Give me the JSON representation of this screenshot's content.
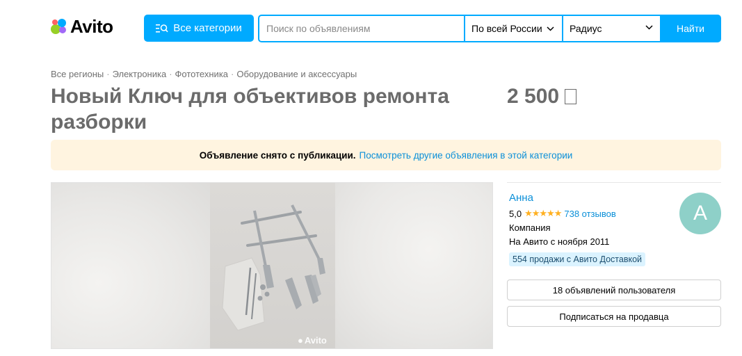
{
  "header": {
    "logo_text": "Avito",
    "logo_colors": [
      "#97cf26",
      "#a169f7",
      "#ff6163",
      "#00aaff"
    ],
    "categories_label": "Все категории",
    "search": {
      "placeholder": "Поиск по объявлениям",
      "value": ""
    },
    "region_label": "По всей России",
    "radius_label": "Радиус",
    "find_label": "Найти",
    "accent_color": "#00aaff"
  },
  "breadcrumb": [
    "Все регионы",
    "Электроника",
    "Фототехника",
    "Оборудование и аксессуары"
  ],
  "listing": {
    "title": "Новый Ключ для объективов ремонта разборки",
    "price": "2 500"
  },
  "notice": {
    "text": "Объявление снято с публикации.",
    "link": "Посмотреть другие объявления в этой категории"
  },
  "gallery": {
    "watermark": "Avito"
  },
  "seller": {
    "name": "Анна",
    "rating": "5,0",
    "stars": "★★★★★",
    "reviews": "738 отзывов",
    "type": "Компания",
    "since": "На Авито с ноября 2011",
    "badge": "554 продажи с Авито Доставкой",
    "avatar_letter": "А",
    "avatar_color": "#8ed0c8",
    "ads_button": "18 объявлений пользователя",
    "subscribe_button": "Подписаться на продавца"
  }
}
